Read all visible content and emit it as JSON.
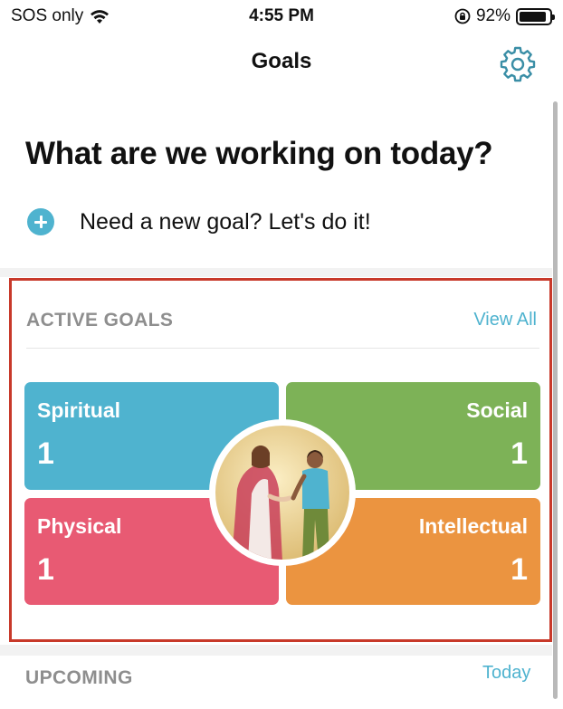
{
  "status_bar": {
    "carrier": "SOS only",
    "time": "4:55 PM",
    "battery": "92%",
    "battery_level": 0.92
  },
  "nav": {
    "title": "Goals",
    "settings_icon": "gear-icon"
  },
  "headline": "What are we working on today?",
  "new_goal": {
    "icon": "plus-circle-icon",
    "label": "Need a new goal? Let's do it!"
  },
  "active_goals": {
    "title": "ACTIVE GOALS",
    "view_all": "View All",
    "cards": [
      {
        "label": "Spiritual",
        "count": "1",
        "color": "#4fb3cf"
      },
      {
        "label": "Social",
        "count": "1",
        "color": "#7db257"
      },
      {
        "label": "Physical",
        "count": "1",
        "color": "#e85a73"
      },
      {
        "label": "Intellectual",
        "count": "1",
        "color": "#eb9440"
      }
    ],
    "highlight_color": "#c8392a"
  },
  "upcoming": {
    "title": "UPCOMING",
    "today": "Today"
  },
  "colors": {
    "accent": "#4fb3cf",
    "section_label": "#8e8e8e"
  }
}
